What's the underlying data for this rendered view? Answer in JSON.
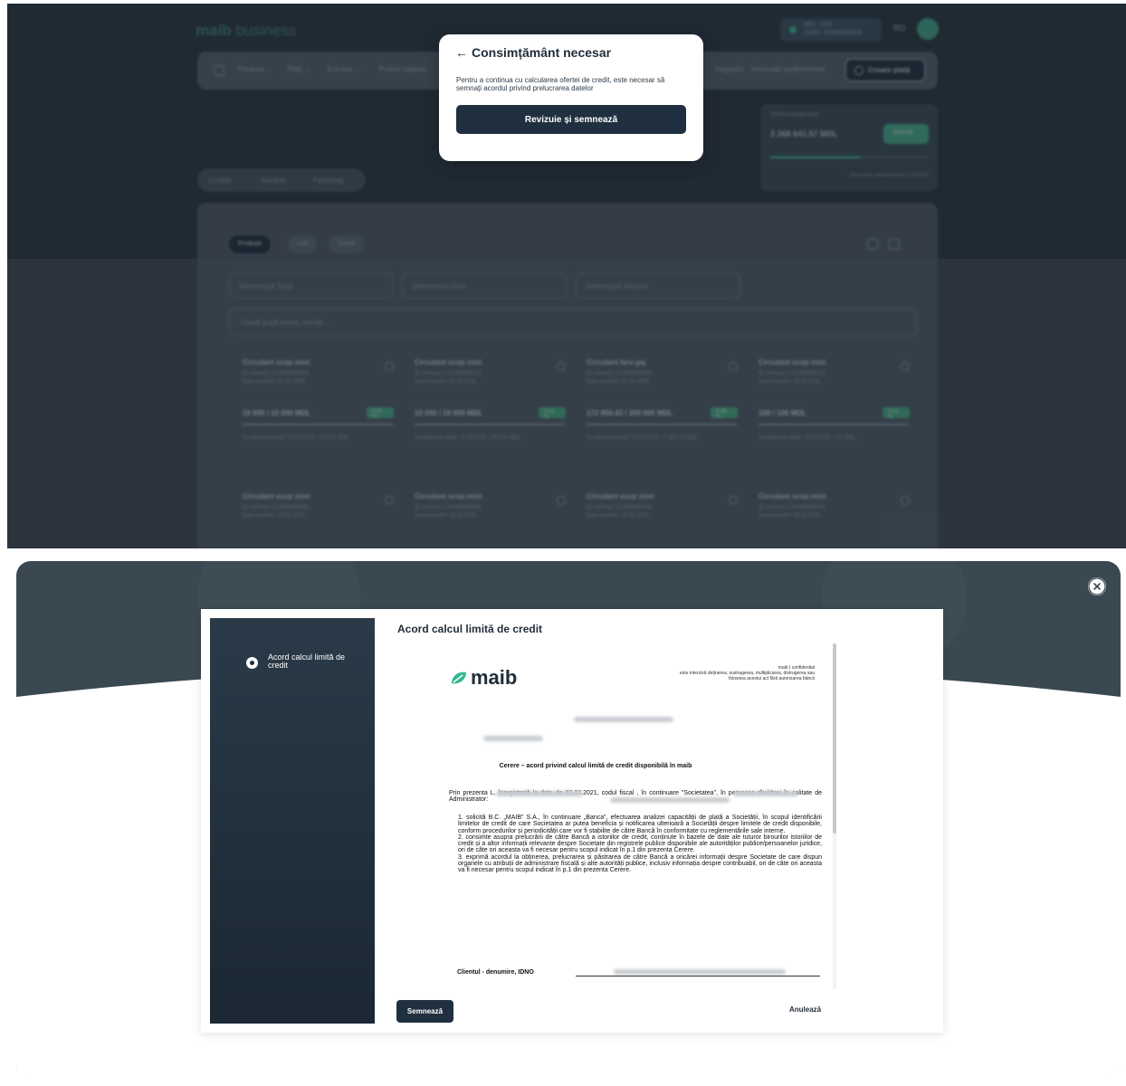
{
  "dashboard": {
    "brand": "maib",
    "brand_suffix": "business",
    "account": {
      "line1": "MDL 1133",
      "line2": "22461 10000000024"
    },
    "language": "RO",
    "nav_items": [
      "Produse ⌄",
      "Plăți ⌄",
      "Extrase ⌄",
      "Proiect salarial",
      "Asigurări",
      "Informații suplimentare"
    ],
    "create_payment": "Creare plată",
    "offer": {
      "label": "Ofertă leasing/credit",
      "amount": "3 268 641.57 MDL",
      "button": "Solicită",
      "note": "Oferta este valabilă până la 15.04.2026"
    },
    "tabs": [
      "Credite",
      "Garanții",
      "Factoring"
    ],
    "segments": [
      "Produse",
      "Linii",
      "Cereri"
    ],
    "filters": [
      "Selectează Tipul",
      "Selectează Linia",
      "Selectează Statutul"
    ],
    "search_placeholder": "Caută după nume, număr...",
    "cards": [
      {
        "name": "Circulant scop mixt",
        "contract": "ID contract: LC0938839621",
        "expiry": "Data expirării: 01.02.2035",
        "amount": "10 000 / 10 000 MDL",
        "pct": "5.67 %",
        "next": "Următoarea plată: 05.03.2026 - 470.32 MDL"
      },
      {
        "name": "Circulant scop mixt",
        "contract": "ID contract: LC0938839621",
        "expiry": "Data expirării: 11.03.2031",
        "amount": "10 000 / 10 000 MDL",
        "pct": "9.01 %",
        "next": "Următoarea plată: 11.03.2026 - 506.94 MDL"
      },
      {
        "name": "Circulant fara gaj",
        "contract": "ID contract: LC0928360621",
        "expiry": "Data expirării: 26.04.2026",
        "amount": "172 856.43 / 200 000 MDL",
        "pct": "9.46 %",
        "next": "Următoarea plată: 26.04.2026 - 7 359.56 MDL"
      },
      {
        "name": "Circulant scop mixt",
        "contract": "ID contract: LC0925460621",
        "expiry": "Data expirării: 15.02.2031",
        "amount": "100 / 100 MDL",
        "pct": "9.01 %",
        "next": "Următoarea plată: 15.03.2026 - 2.2 MDL"
      },
      {
        "name": "Circulant scop mixt",
        "contract": "ID contract: LC0925460095",
        "expiry": "Data expirării: 26.02.2031",
        "amount": "",
        "pct": "",
        "next": ""
      },
      {
        "name": "Circulant scop mixt",
        "contract": "ID contract: LC0925460558",
        "expiry": "Data expirării: 02.03.2031",
        "amount": "",
        "pct": "",
        "next": ""
      },
      {
        "name": "Circulant scop mixt",
        "contract": "ID contract: LC0925460182",
        "expiry": "Data expirării: 05.03.2031",
        "amount": "",
        "pct": "",
        "next": ""
      },
      {
        "name": "Circulant scop mixt",
        "contract": "ID contract: LC0925460755",
        "expiry": "Data expirării: 09.03.2031",
        "amount": "",
        "pct": "",
        "next": ""
      }
    ]
  },
  "consent_modal": {
    "back_icon": "arrow-left-icon",
    "title": "Consimțământ necesar",
    "message": "Pentru a continua cu calcularea ofertei de credit, este necesar să semnați acordul privind prelucrarea datelor",
    "button": "Revizuie și semnează"
  },
  "agreement_dialog": {
    "close_icon": "close-icon",
    "step_label": "Acord calcul limită de credit",
    "heading": "Acord calcul limită de credit",
    "document": {
      "logo": "maib",
      "confidential_1": "maib | confidential",
      "confidential_2": "este interzisă deținerea, sustragerea, multiplicarea, distrugerea sau",
      "confidential_3": "folosirea acestui act fără autorizarea băncii",
      "title": "Cerere – acord privind calcul limită de credit disponibilă în maib",
      "intro": "Prin prezenta                          L, înregistrată la data de 02.02.2021, codul fiscal                          , în continuare \"Societatea\", în persoana dlui/dnei                                                        în calitate de Administrator:",
      "clause1": "1. solicită B.C. „MAIB” S.A., în continuare „Banca”, efectuarea analizei capacității de plată a Societății, în scopul identificării limitelor de credit de care Societatea ar putea beneficia și notificarea ulterioară a Societății despre limitele de credit disponibile, conform procedurilor și periodicității care vor fi stabilite de către Bancă în conformitate cu reglementările sale interne.",
      "clause2": "2. consimte asupra prelucrării de către Bancă a istoriilor de credit, conținute în bazele de date ale tuturor birourilor istoriilor de credit și a altor informații relevante despre Societate din registrele publice disponibile ale autorităților publice/persoanelor juridice, ori de câte ori aceasta va fi necesar pentru scopul indicat în p.1 din prezenta Cerere.",
      "clause3": "3. exprimă acordul la obținerea, prelucrarea și păstrarea de către Bancă a oricărei informații despre Societate de care dispun organele cu atribuții de administrare fiscală și alte autorități publice, inclusiv informația despre contribuabil, ori de câte ori aceasta va fi necesar pentru scopul indicat în p.1 din prezenta Cerere.",
      "client_label": "Clientul - denumire, IDNO"
    },
    "sign_button": "Semnează",
    "cancel_button": "Anulează"
  }
}
